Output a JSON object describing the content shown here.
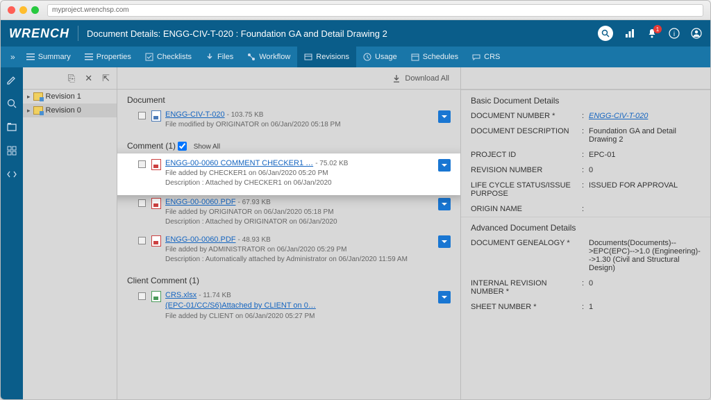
{
  "browser": {
    "url": "myproject.wrenchsp.com"
  },
  "header": {
    "logo": "WRENCH",
    "title": "Document Details: ENGG-CIV-T-020 : Foundation GA and Detail Drawing 2",
    "badge": "1"
  },
  "tabs": [
    "Summary",
    "Properties",
    "Checklists",
    "Files",
    "Workflow",
    "Revisions",
    "Usage",
    "Schedules",
    "CRS"
  ],
  "active_tab": 5,
  "revisions": [
    "Revision 1",
    "Revision 0"
  ],
  "toolbar": {
    "download_all": "Download All"
  },
  "sections": {
    "document": "Document",
    "comment": "Comment (1)",
    "showall": "Show All",
    "client": "Client Comment (1)"
  },
  "files": {
    "doc": {
      "name": "ENGG-CIV-T-020",
      "size": "- 103.75 KB",
      "meta": "File modified by ORIGINATOR on 06/Jan/2020 05:18 PM"
    },
    "hl": {
      "name": "ENGG-00-0060 COMMENT CHECKER1 …",
      "size": "- 75.02 KB",
      "meta1": "File added by CHECKER1 on 06/Jan/2020 05:20 PM",
      "meta2": "Description : Attached by CHECKER1 on 06/Jan/2020"
    },
    "c1": {
      "name": "ENGG-00-0060.PDF",
      "size": "- 67.93 KB",
      "meta1": "File added by ORIGINATOR on 06/Jan/2020 05:18 PM",
      "meta2": "Description : Attached by ORIGINATOR on 06/Jan/2020"
    },
    "c2": {
      "name": "ENGG-00-0060.PDF",
      "size": "- 48.93 KB",
      "meta1": "File added by ADMINISTRATOR on 06/Jan/2020 05:29 PM",
      "meta2": "Description : Automatically attached by Administrator on 06/Jan/2020 11:59 AM"
    },
    "cl": {
      "name": "CRS.xlsx",
      "size": "- 11.74 KB",
      "sub": "(EPC-01/CC/S6)Attached by CLIENT on 0…",
      "meta": "File added by CLIENT on 06/Jan/2020 05:27 PM"
    }
  },
  "details": {
    "basic_title": "Basic Document Details",
    "adv_title": "Advanced Document Details",
    "rows": {
      "docnum": {
        "l": "DOCUMENT NUMBER *",
        "v": "ENGG-CIV-T-020"
      },
      "desc": {
        "l": "DOCUMENT DESCRIPTION",
        "v": "Foundation GA and Detail Drawing 2"
      },
      "proj": {
        "l": "PROJECT ID",
        "v": "EPC-01"
      },
      "rev": {
        "l": "REVISION NUMBER",
        "v": "0"
      },
      "life": {
        "l": "LIFE CYCLE STATUS/ISSUE PURPOSE",
        "v": "ISSUED FOR APPROVAL"
      },
      "orig": {
        "l": "ORIGIN NAME",
        "v": ""
      },
      "gen": {
        "l": "DOCUMENT GENEALOGY *",
        "v": "Documents(Documents)-->EPC(EPC)-->1.0 (Engineering)-->1.30 (Civil and Structural Design)"
      },
      "intrev": {
        "l": "INTERNAL REVISION NUMBER *",
        "v": "0"
      },
      "sheet": {
        "l": "SHEET NUMBER *",
        "v": "1"
      }
    }
  }
}
